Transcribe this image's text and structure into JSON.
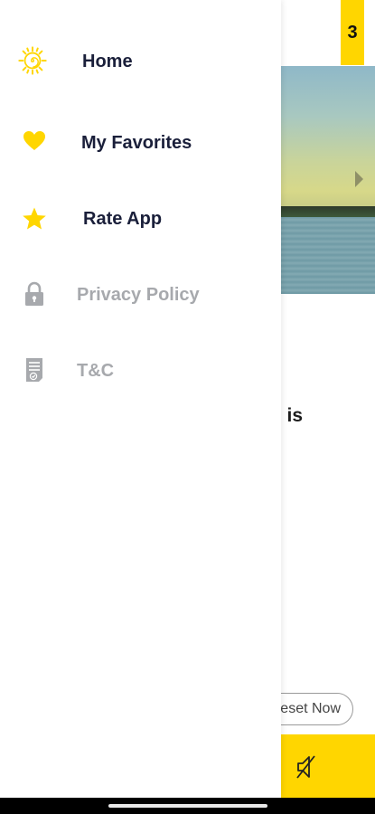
{
  "background": {
    "badge_text": "3",
    "content_text": "e is",
    "reset_button_label": "eset Now",
    "image_icon": "scenic-lake-sunset-image",
    "mute_icon": "speaker-mute-icon",
    "accent_color": "#FFD600"
  },
  "drawer": {
    "items": [
      {
        "label": "Home",
        "icon": "sun-icon",
        "muted": false
      },
      {
        "label": "My Favorites",
        "icon": "heart-icon",
        "muted": false
      },
      {
        "label": "Rate App",
        "icon": "star-icon",
        "muted": false
      },
      {
        "label": "Privacy Policy",
        "icon": "lock-icon",
        "muted": true
      },
      {
        "label": "T&C",
        "icon": "document-icon",
        "muted": true
      }
    ],
    "icon_color_active": "#FFD600",
    "icon_color_muted": "#a7a9ad",
    "label_color_active": "#1a1f3a",
    "label_color_muted": "#a7a9ad"
  }
}
